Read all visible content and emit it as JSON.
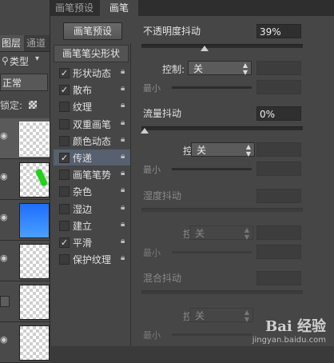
{
  "layers": {
    "tabs": [
      "图层",
      "通道"
    ],
    "kind_label": "类型",
    "blend_mode": "正常",
    "lock_label": "锁定:"
  },
  "brush_panel": {
    "tabs": [
      "画笔预设",
      "画笔"
    ],
    "preset_button": "画笔预设",
    "list_header": "画笔笔尖形状",
    "items": [
      {
        "label": "形状动态",
        "checked": true
      },
      {
        "label": "散布",
        "checked": true
      },
      {
        "label": "纹理",
        "checked": false
      },
      {
        "label": "双重画笔",
        "checked": false
      },
      {
        "label": "颜色动态",
        "checked": false
      },
      {
        "label": "传递",
        "checked": true
      },
      {
        "label": "画笔笔势",
        "checked": false
      },
      {
        "label": "杂色",
        "checked": false
      },
      {
        "label": "湿边",
        "checked": false
      },
      {
        "label": "建立",
        "checked": false
      },
      {
        "label": "平滑",
        "checked": true
      },
      {
        "label": "保护纹理",
        "checked": false
      }
    ],
    "settings": {
      "opacity_jitter": {
        "label": "不透明度抖动",
        "value": "39%",
        "level": 0.39
      },
      "control_1": {
        "label": "控制:",
        "value": "关"
      },
      "min_1": "最小",
      "flow_jitter": {
        "label": "流量抖动",
        "value": "0%",
        "level": 0
      },
      "control_2": {
        "label": "控制:",
        "value": "关"
      },
      "min_2": "最小",
      "wetness_jitter": {
        "label": "湿度抖动"
      },
      "control_3": {
        "label": "控制:",
        "value": "关"
      },
      "min_3": "最小",
      "mix_jitter": {
        "label": "混合抖动"
      },
      "control_4": {
        "label": "控制:",
        "value": "关"
      },
      "min_4": "最小"
    }
  },
  "watermark": {
    "brand": "Bai 经验",
    "url": "jingyan.baidu.com"
  }
}
